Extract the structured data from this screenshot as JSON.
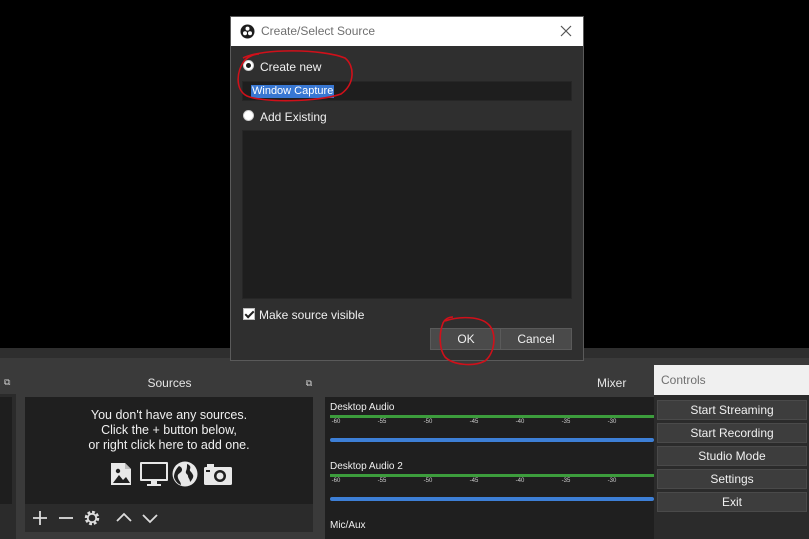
{
  "dialog": {
    "title": "Create/Select Source",
    "create_new_label": "Create new",
    "source_name_value": "Window Capture",
    "add_existing_label": "Add Existing",
    "make_visible_label": "Make source visible",
    "make_visible_checked": true,
    "selected_option": "create_new",
    "ok_label": "OK",
    "cancel_label": "Cancel"
  },
  "sources": {
    "title": "Sources",
    "empty_line1": "You don't have any sources.",
    "empty_line2": "Click the + button below,",
    "empty_line3": "or right click here to add one.",
    "icons": [
      "image-icon",
      "display-icon",
      "globe-icon",
      "camera-icon"
    ]
  },
  "mixer": {
    "title": "Mixer",
    "channels": [
      {
        "name": "Desktop Audio"
      },
      {
        "name": "Desktop Audio 2"
      },
      {
        "name": "Mic/Aux"
      }
    ],
    "tick_labels": [
      "-60",
      "-55",
      "-50",
      "-45",
      "-40",
      "-35",
      "-30"
    ]
  },
  "controls": {
    "title": "Controls",
    "buttons": [
      "Start Streaming",
      "Start Recording",
      "Studio Mode",
      "Settings",
      "Exit"
    ]
  },
  "colors": {
    "accent_selection": "#3877d2",
    "meter_green": "#3c9c3c",
    "fader_blue": "#3d7fd6",
    "annotation_red": "#d0101a"
  }
}
